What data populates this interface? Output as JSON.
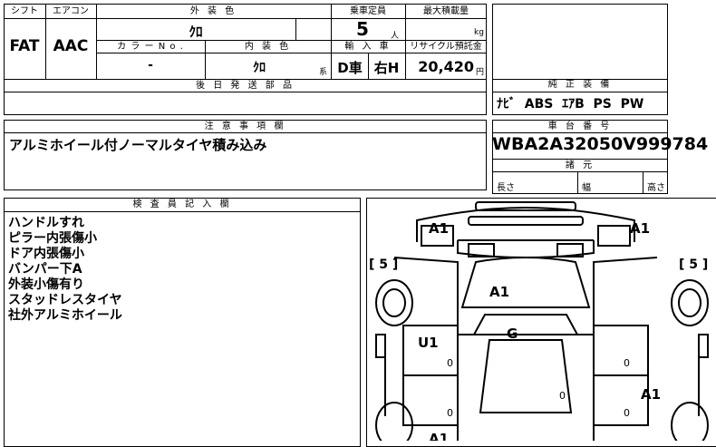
{
  "top": {
    "headers": {
      "shift": "シフト",
      "aircon": "エアコン",
      "exterior_color": "外 装 色",
      "capacity": "乗車定員",
      "max_load": "最大積載量",
      "color_no": "カ ラ ー N o .",
      "interior_color": "内 装 色",
      "import": "輸 入 車",
      "recycle": "リサイクル預託金",
      "later_parts": "後 日 発 送 部 品",
      "genuine_equipment": "純 正 装 備"
    },
    "values": {
      "shift": "FAT",
      "aircon": "AAC",
      "exterior_color": "ｸﾛ",
      "capacity": "5",
      "capacity_unit": "人",
      "max_load_unit": "kg",
      "color_no": "-",
      "interior_color": "ｸﾛ",
      "interior_unit": "系",
      "import_d": "D車",
      "import_side": "右H",
      "recycle_amount": "20,420",
      "recycle_unit": "円",
      "genuine_equipment": "ﾅﾋﾞ  ABS  ｴｱB  PS  PW"
    }
  },
  "notes": {
    "header": "注 意 事 項 欄",
    "text": "アルミホイール付ノーマルタイヤ積み込み"
  },
  "chassis": {
    "header": "車 台 番 号",
    "number": "WBA2A32050V999784",
    "specs_header": "諸 元",
    "length": "長さ",
    "width": "幅",
    "height": "高さ"
  },
  "inspector": {
    "header": "検 査 員 記 入 欄",
    "items": [
      "ハンドルすれ",
      "ピラー内張傷小",
      "ドア内張傷小",
      "バンパー下A",
      "外装小傷有り",
      "スタッドレスタイヤ",
      "社外アルミホイール"
    ]
  },
  "diagram": {
    "front_left": "A1",
    "front_right": "A1",
    "left_tire": "[ 5 ]",
    "right_tire": "[ 5 ]",
    "hood": "A1",
    "roof": "G",
    "left_door": "U1",
    "right_rear": "A1",
    "zero_labels": [
      "0",
      "0",
      "0",
      "0",
      "0"
    ],
    "bottom_partial": "A1"
  }
}
